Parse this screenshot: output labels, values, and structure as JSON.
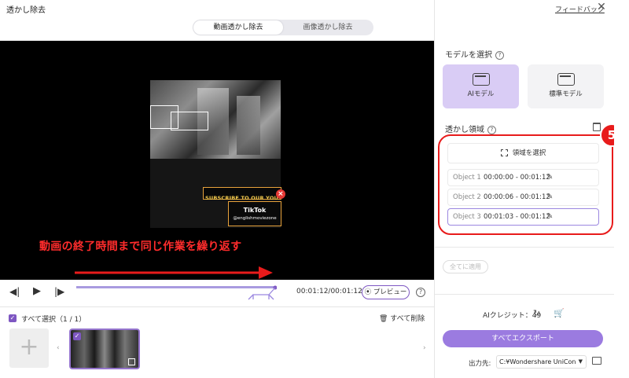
{
  "header": {
    "title": "透かし除去",
    "feedback": "フィードバック",
    "close": "✕"
  },
  "tabs": [
    "動画透かし除去",
    "画像透かし除去"
  ],
  "video": {
    "watermark_text": "SUBSCRIBE TO OUR YOU",
    "tiktok_label": "TikTok",
    "tiktok_handle": "@englishmoviezone",
    "overlay_caption": "動画の終了時間まで同じ作業を繰り返す"
  },
  "timeline": {
    "timecode": "00:01:12/00:01:12",
    "preview_label": "プレビュー"
  },
  "clips": {
    "select_all_label": "すべて選択（1 / 1）",
    "delete_all_label": "すべて削除"
  },
  "panel": {
    "model_title": "モデルを選択",
    "models": [
      {
        "label": "AIモデル",
        "selected": true
      },
      {
        "label": "標準モデル",
        "selected": false
      }
    ],
    "region_title": "透かし領域",
    "select_region": "領域を選択",
    "step_badge": "5",
    "objects": [
      {
        "name": "Object 1",
        "time": "00:00:00 - 00:01:12"
      },
      {
        "name": "Object 2",
        "time": "00:00:06 - 00:01:12"
      },
      {
        "name": "Object 3",
        "time": "00:01:03 - 00:01:12"
      }
    ],
    "apply_all": "全てに適用",
    "ai_credit": "AIクレジット：49",
    "export_all": "すべてエクスポート",
    "output_label": "出力先:",
    "output_path": "C:¥Wondershare UniCon"
  },
  "colors": {
    "accent": "#9b7be0",
    "annotation_red": "#e81b1b"
  }
}
